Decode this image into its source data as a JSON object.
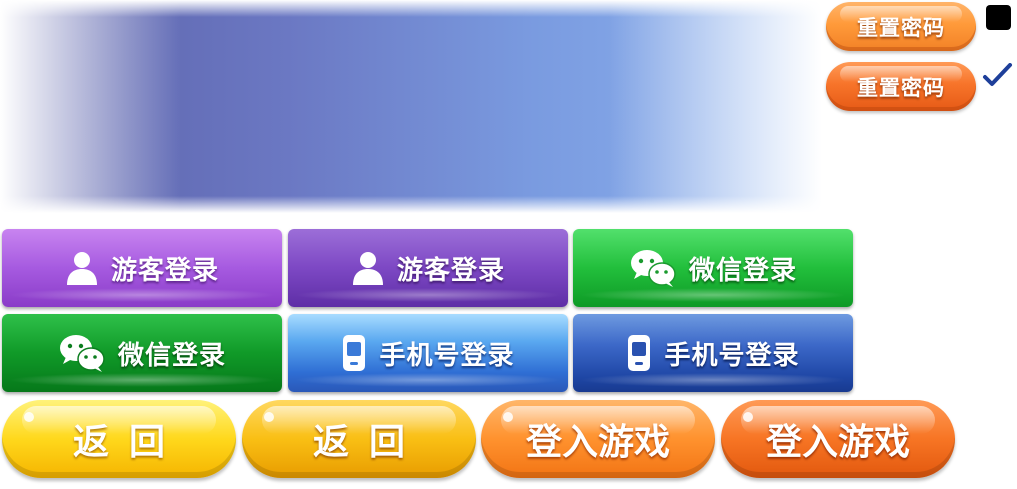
{
  "reset_password": {
    "label_normal": "重置密码",
    "label_pressed": "重置密码"
  },
  "checkboxes": {
    "unchecked_icon": "black-square-icon",
    "checked_icon": "checkmark-icon"
  },
  "login_tiles": [
    {
      "label": "游客登录",
      "icon": "user-icon",
      "color": "#a65ae0"
    },
    {
      "label": "游客登录",
      "icon": "user-icon",
      "color": "#7d48c4"
    },
    {
      "label": "微信登录",
      "icon": "wechat-icon",
      "color": "#22bf3c"
    },
    {
      "label": "微信登录",
      "icon": "wechat-icon",
      "color": "#109a28"
    },
    {
      "label": "手机号登录",
      "icon": "phone-icon",
      "color": "#5aa8f0"
    },
    {
      "label": "手机号登录",
      "icon": "phone-icon",
      "color": "#3c68c8"
    }
  ],
  "pills": [
    {
      "label": "返回",
      "color": "#ffd81c"
    },
    {
      "label": "返回",
      "color": "#f9bf14"
    },
    {
      "label": "登入游戏",
      "color": "#ff922e"
    },
    {
      "label": "登入游戏",
      "color": "#f77524"
    }
  ]
}
